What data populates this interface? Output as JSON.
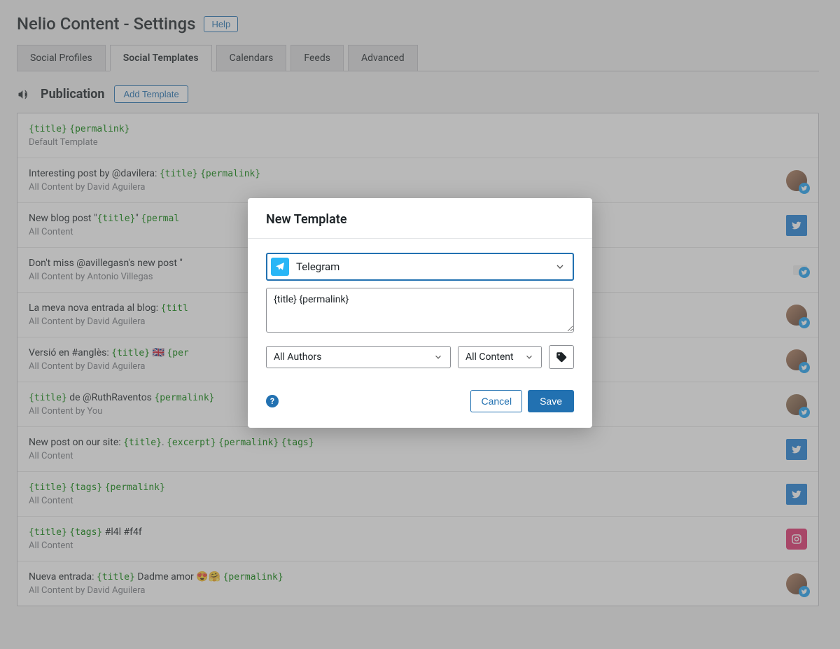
{
  "header": {
    "title": "Nelio Content - Settings",
    "help_label": "Help"
  },
  "tabs": [
    {
      "label": "Social Profiles",
      "active": false
    },
    {
      "label": "Social Templates",
      "active": true
    },
    {
      "label": "Calendars",
      "active": false
    },
    {
      "label": "Feeds",
      "active": false
    },
    {
      "label": "Advanced",
      "active": false
    }
  ],
  "section": {
    "title": "Publication",
    "add_template_label": "Add Template"
  },
  "templates": [
    {
      "segments": [
        {
          "t": "placeholder",
          "text": "{title}"
        },
        {
          "t": "text",
          "text": " "
        },
        {
          "t": "placeholder",
          "text": "{permalink}"
        }
      ],
      "subtitle": "Default Template",
      "right": {
        "type": "none"
      }
    },
    {
      "segments": [
        {
          "t": "text",
          "text": "Interesting post by @davilera: "
        },
        {
          "t": "placeholder",
          "text": "{title}"
        },
        {
          "t": "text",
          "text": " "
        },
        {
          "t": "placeholder",
          "text": "{permalink}"
        }
      ],
      "subtitle": "All Content by David Aguilera",
      "right": {
        "type": "avatar-twitter",
        "avatar": "a1"
      }
    },
    {
      "segments": [
        {
          "t": "text",
          "text": "New blog post \""
        },
        {
          "t": "placeholder",
          "text": "{title}"
        },
        {
          "t": "text",
          "text": "\" "
        },
        {
          "t": "placeholder",
          "text": "{permal"
        }
      ],
      "subtitle": "All Content",
      "right": {
        "type": "twitter-square"
      }
    },
    {
      "segments": [
        {
          "t": "text",
          "text": "Don't miss @avillegasn's new post \""
        }
      ],
      "subtitle": "All Content by Antonio Villegas",
      "right": {
        "type": "tiny-twitter"
      }
    },
    {
      "segments": [
        {
          "t": "text",
          "text": "La meva nova entrada al blog: "
        },
        {
          "t": "placeholder",
          "text": "{titl"
        }
      ],
      "subtitle": "All Content by David Aguilera",
      "right": {
        "type": "avatar-twitter",
        "avatar": "a1"
      }
    },
    {
      "segments": [
        {
          "t": "text",
          "text": "Versió en #anglès: "
        },
        {
          "t": "placeholder",
          "text": "{title}"
        },
        {
          "t": "text",
          "text": " 🇬🇧 "
        },
        {
          "t": "placeholder",
          "text": "{per"
        }
      ],
      "subtitle": "All Content by David Aguilera",
      "right": {
        "type": "avatar-twitter",
        "avatar": "a1"
      }
    },
    {
      "segments": [
        {
          "t": "placeholder",
          "text": "{title}"
        },
        {
          "t": "text",
          "text": " de @RuthRaventos "
        },
        {
          "t": "placeholder",
          "text": "{permalink}"
        }
      ],
      "subtitle": "All Content by You",
      "right": {
        "type": "avatar-twitter",
        "avatar": "a3"
      }
    },
    {
      "segments": [
        {
          "t": "text",
          "text": "New post on our site: "
        },
        {
          "t": "placeholder",
          "text": "{title}"
        },
        {
          "t": "text",
          "text": ". "
        },
        {
          "t": "placeholder",
          "text": "{excerpt}"
        },
        {
          "t": "text",
          "text": " "
        },
        {
          "t": "placeholder",
          "text": "{permalink}"
        },
        {
          "t": "text",
          "text": " "
        },
        {
          "t": "placeholder",
          "text": "{tags}"
        }
      ],
      "subtitle": "All Content",
      "right": {
        "type": "twitter-square"
      }
    },
    {
      "segments": [
        {
          "t": "placeholder",
          "text": "{title}"
        },
        {
          "t": "text",
          "text": " "
        },
        {
          "t": "placeholder",
          "text": "{tags}"
        },
        {
          "t": "text",
          "text": " "
        },
        {
          "t": "placeholder",
          "text": "{permalink}"
        }
      ],
      "subtitle": "All Content",
      "right": {
        "type": "twitter-square"
      }
    },
    {
      "segments": [
        {
          "t": "placeholder",
          "text": "{title}"
        },
        {
          "t": "text",
          "text": " "
        },
        {
          "t": "placeholder",
          "text": "{tags}"
        },
        {
          "t": "text",
          "text": " #l4l #f4f"
        }
      ],
      "subtitle": "All Content",
      "right": {
        "type": "instagram-square"
      }
    },
    {
      "segments": [
        {
          "t": "text",
          "text": "Nueva entrada: "
        },
        {
          "t": "placeholder",
          "text": "{title}"
        },
        {
          "t": "text",
          "text": " Dadme amor 😍🤗 "
        },
        {
          "t": "placeholder",
          "text": "{permalink}"
        }
      ],
      "subtitle": "All Content by David Aguilera",
      "right": {
        "type": "avatar-twitter",
        "avatar": "a1"
      }
    }
  ],
  "modal": {
    "title": "New Template",
    "select_label": "Telegram",
    "textarea_value": "{title} {permalink}",
    "authors_label": "All Authors",
    "content_label": "All Content",
    "cancel_label": "Cancel",
    "save_label": "Save"
  }
}
